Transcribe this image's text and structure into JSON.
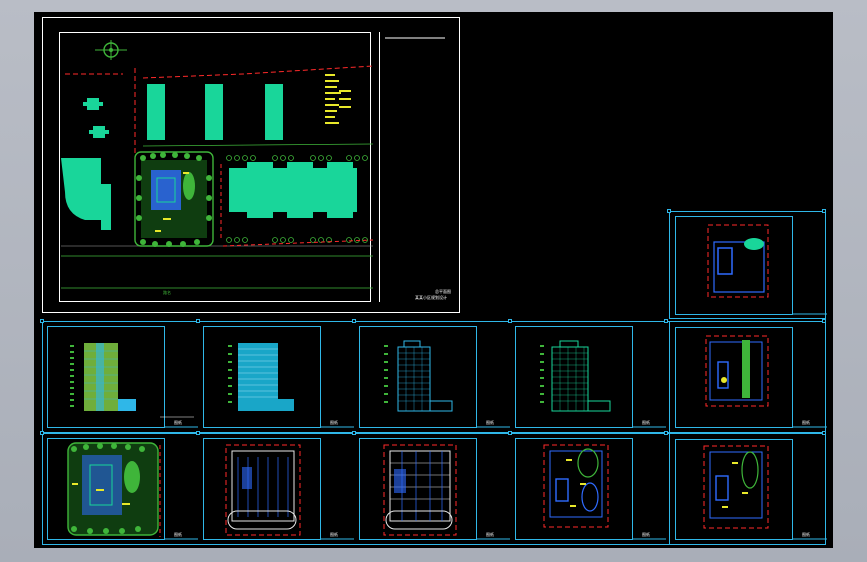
{
  "sheet": {
    "site_plan": {
      "title_lines": [
        "总平面图",
        "某某小区规划设计"
      ],
      "road_label": "路名"
    },
    "sheet_stamp": "图纸"
  },
  "colors": {
    "background": "#000000",
    "frame_white": "#ffffff",
    "frame_cyan": "#2fb7e8",
    "building_cyan": "#19d69a",
    "tree_green": "#3fb53a",
    "dash_red": "#ff2a2a",
    "plan_blue": "#2f6bff",
    "wall_white": "#e8e8e8"
  },
  "panels": [
    {
      "id": "elevation-1",
      "type": "elevation"
    },
    {
      "id": "elevation-2",
      "type": "elevation"
    },
    {
      "id": "elevation-3",
      "type": "elevation"
    },
    {
      "id": "elevation-4",
      "type": "elevation"
    },
    {
      "id": "plan-roof",
      "type": "floor-plan"
    },
    {
      "id": "plan-upper",
      "type": "floor-plan"
    },
    {
      "id": "plan-site-detail",
      "type": "site-plan"
    },
    {
      "id": "plan-basement-1",
      "type": "floor-plan"
    },
    {
      "id": "plan-basement-2",
      "type": "floor-plan"
    },
    {
      "id": "plan-ground",
      "type": "floor-plan"
    },
    {
      "id": "plan-second",
      "type": "floor-plan"
    }
  ]
}
